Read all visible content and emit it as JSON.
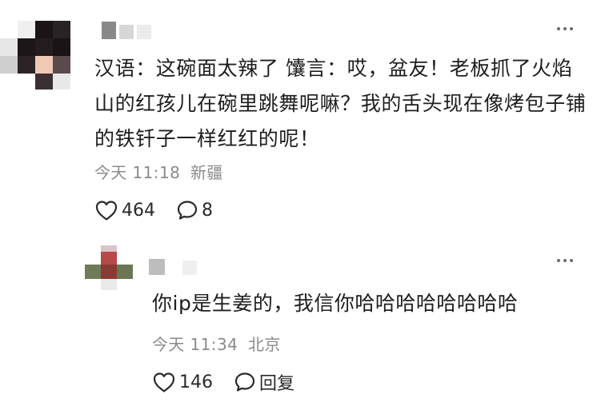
{
  "colors": {
    "text_primary": "#1e1e1e",
    "text_meta": "#8a8a8a",
    "icon": "#2a2a2a"
  },
  "comment": {
    "text": "汉语：这碗面太辣了 馕言：哎，盆友！老板抓了火焰山的红孩儿在碗里跳舞呢嘛？我的舌头现在像烤包子铺的铁钎子一样红红的呢！",
    "time": "今天 11:18",
    "location": "新疆",
    "like_icon": "heart-outline-icon",
    "like_count": "464",
    "reply_icon": "speech-bubble-icon",
    "reply_count": "8",
    "more_icon": "more-dots-icon"
  },
  "reply": {
    "text": "你ip是生姜的，我信你哈哈哈哈哈哈哈哈",
    "time": "今天 11:34",
    "location": "北京",
    "like_icon": "heart-outline-icon",
    "like_count": "146",
    "reply_icon": "speech-bubble-icon",
    "reply_label": "回复",
    "more_icon": "more-dots-icon"
  }
}
